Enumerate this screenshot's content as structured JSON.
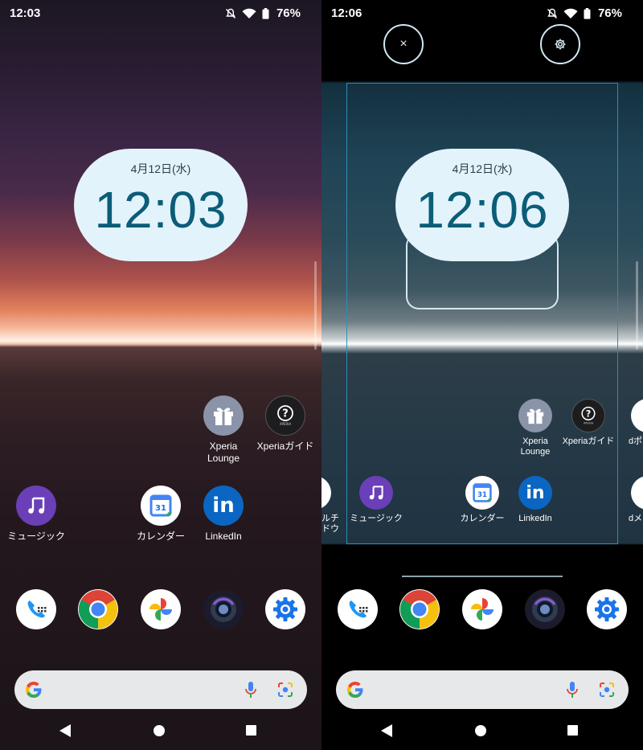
{
  "left": {
    "status": {
      "time": "12:03",
      "battery": "76%"
    },
    "widget": {
      "date": "4月12日(水)",
      "time": "12:03"
    },
    "apps": {
      "xperia_lounge": "Xperia\nLounge",
      "xperia_guide": "Xperiaガイド",
      "music": "ミュージック",
      "calendar": "カレンダー",
      "linkedin": "LinkedIn"
    }
  },
  "right": {
    "status": {
      "time": "12:06",
      "battery": "76%"
    },
    "widget": {
      "date": "4月12日(水)",
      "time": "12:06"
    },
    "apps": {
      "xperia_lounge": "Xperia\nLounge",
      "xperia_guide": "Xperiaガイド",
      "music": "ミュージック",
      "calendar": "カレンダー",
      "linkedin": "LinkedIn",
      "left_partial": "ルチ\nドウ",
      "right_top_partial": "dポ",
      "right_bottom_partial": "dメ"
    },
    "close_symbol": "×"
  },
  "calendar_day": "31",
  "icons": {
    "status": [
      "dnd-off-icon",
      "wifi-icon",
      "battery-icon"
    ],
    "dock": [
      "phone-icon",
      "chrome-icon",
      "photos-icon",
      "camera-icon",
      "settings-icon"
    ],
    "search": [
      "google-g-icon",
      "mic-icon",
      "lens-icon"
    ],
    "nav": [
      "back-icon",
      "home-icon",
      "recents-icon"
    ]
  },
  "colors": {
    "clock_bg": "#e3f3fb",
    "clock_text": "#0b5d78",
    "search_bg": "#e7e8ea",
    "edit_frame": "#2b8fb8",
    "music_icon": "#6a3fb8",
    "linkedin_icon": "#0a66c2"
  }
}
